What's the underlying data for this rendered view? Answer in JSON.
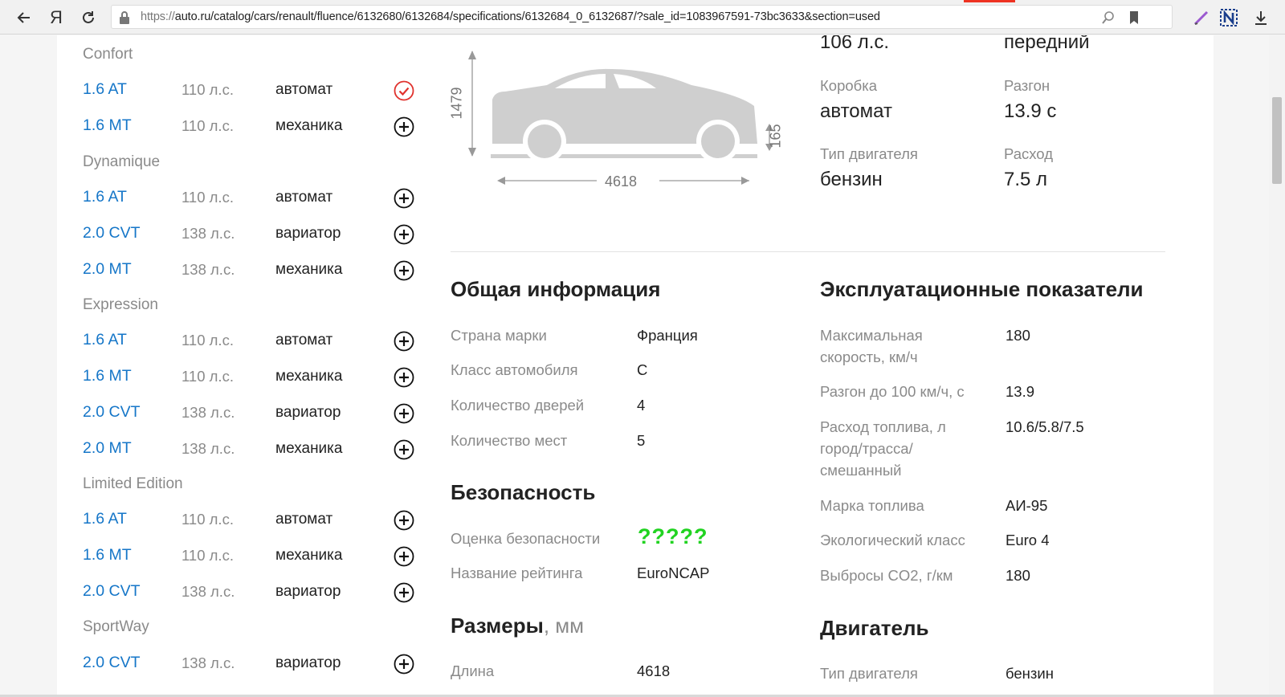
{
  "browser": {
    "url_scheme": "https://",
    "url_rest": "auto.ru/catalog/cars/renault/fluence/6132680/6132684/specifications/6132684_0_6132687/?sale_id=1083967591-73bc3633&section=used",
    "yandex_glyph": "Я"
  },
  "modifications": {
    "groups": [
      {
        "title": "Confort",
        "rows": [
          {
            "name": "1.6 AT",
            "power": "110 л.с.",
            "trans": "автомат",
            "state": "selected"
          },
          {
            "name": "1.6 MT",
            "power": "110 л.с.",
            "trans": "механика",
            "state": "add"
          }
        ]
      },
      {
        "title": "Dynamique",
        "rows": [
          {
            "name": "1.6 AT",
            "power": "110 л.с.",
            "trans": "автомат",
            "state": "add"
          },
          {
            "name": "2.0 CVT",
            "power": "138 л.с.",
            "trans": "вариатор",
            "state": "add"
          },
          {
            "name": "2.0 MT",
            "power": "138 л.с.",
            "trans": "механика",
            "state": "add"
          }
        ]
      },
      {
        "title": "Expression",
        "rows": [
          {
            "name": "1.6 AT",
            "power": "110 л.с.",
            "trans": "автомат",
            "state": "add"
          },
          {
            "name": "1.6 MT",
            "power": "110 л.с.",
            "trans": "механика",
            "state": "add"
          },
          {
            "name": "2.0 CVT",
            "power": "138 л.с.",
            "trans": "вариатор",
            "state": "add"
          },
          {
            "name": "2.0 MT",
            "power": "138 л.с.",
            "trans": "механика",
            "state": "add"
          }
        ]
      },
      {
        "title": "Limited Edition",
        "rows": [
          {
            "name": "1.6 AT",
            "power": "110 л.с.",
            "trans": "автомат",
            "state": "add"
          },
          {
            "name": "1.6 MT",
            "power": "110 л.с.",
            "trans": "механика",
            "state": "add"
          },
          {
            "name": "2.0 CVT",
            "power": "138 л.с.",
            "trans": "вариатор",
            "state": "add"
          }
        ]
      },
      {
        "title": "SportWay",
        "rows": [
          {
            "name": "2.0 CVT",
            "power": "138 л.с.",
            "trans": "вариатор",
            "state": "add"
          }
        ]
      }
    ]
  },
  "diagram": {
    "height": "1479",
    "clearance": "165",
    "length": "4618"
  },
  "summary": {
    "power_value": "106 л.с.",
    "drive_value": "передний",
    "gearbox_label": "Коробка",
    "gearbox_value": "автомат",
    "accel_label": "Разгон",
    "accel_value": "13.9 с",
    "engine_label": "Тип двигателя",
    "engine_value": "бензин",
    "fuel_label": "Расход",
    "fuel_value": "7.5 л"
  },
  "general": {
    "title": "Общая информация",
    "rows": [
      {
        "label": "Страна марки",
        "value": "Франция"
      },
      {
        "label": "Класс автомобиля",
        "value": "C"
      },
      {
        "label": "Количество дверей",
        "value": "4"
      },
      {
        "label": "Количество мест",
        "value": "5"
      }
    ]
  },
  "safety": {
    "title": "Безопасность",
    "rating_label": "Оценка безопасности",
    "rating_value": "?????",
    "name_label": "Название рейтинга",
    "name_value": "EuroNCAP"
  },
  "sizes": {
    "title": "Размеры",
    "unit": ", мм",
    "length_label": "Длина",
    "length_value": "4618"
  },
  "performance": {
    "title": "Эксплуатационные показатели",
    "rows": [
      {
        "label": "Максимальная скорость, км/ч",
        "value": "180"
      },
      {
        "label": "Разгон до 100 км/ч, с",
        "value": "13.9"
      },
      {
        "label": "Расход топлива, л город/трасса/смешанный",
        "value": "10.6/5.8/7.5"
      },
      {
        "label": "Марка топлива",
        "value": "АИ-95"
      },
      {
        "label": "Экологический класс",
        "value": "Euro 4"
      },
      {
        "label": "Выбросы CO2, г/км",
        "value": "180"
      }
    ]
  },
  "engine": {
    "title": "Двигатель",
    "type_label": "Тип двигателя",
    "type_value": "бензин"
  },
  "colors": {
    "link": "#1576c8",
    "selected": "#e0322d",
    "stars": "#21d321",
    "muted": "#8a8a8a"
  }
}
